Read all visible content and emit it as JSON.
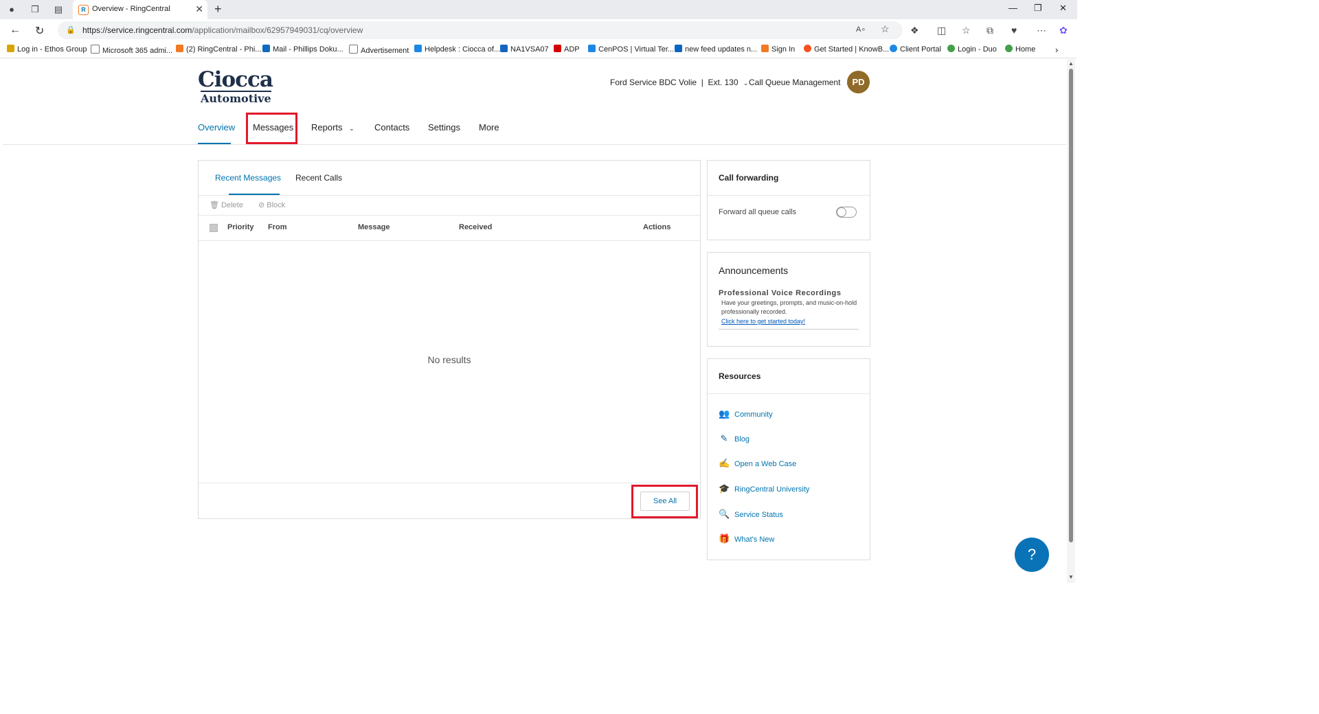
{
  "browser": {
    "tab_title": "Overview - RingCentral",
    "url_host": "https://service.ringcentral.com",
    "url_path": "/application/mailbox/62957949031/cq/overview",
    "bookmarks": [
      {
        "label": "Log in - Ethos Group",
        "color": "#d9a400"
      },
      {
        "label": "Microsoft 365 admi...",
        "color": "#777777"
      },
      {
        "label": "(2) RingCentral - Phi...",
        "color": "#f27a24"
      },
      {
        "label": "Mail - Phillips Doku...",
        "color": "#0f6cbd"
      },
      {
        "label": "Advertisement",
        "color": "#777777"
      },
      {
        "label": "Helpdesk : Ciocca of...",
        "color": "#1e88e5"
      },
      {
        "label": "NA1VSA07",
        "color": "#1565c0"
      },
      {
        "label": "ADP",
        "color": "#d50000"
      },
      {
        "label": "CenPOS | Virtual Ter...",
        "color": "#1e88e5"
      },
      {
        "label": "new feed updates n...",
        "color": "#0a66c2"
      },
      {
        "label": "Sign In",
        "color": "#f27a24"
      },
      {
        "label": "Get Started | KnowB...",
        "color": "#f4511e"
      },
      {
        "label": "Client Portal",
        "color": "#1e88e5"
      },
      {
        "label": "Login - Duo",
        "color": "#43a047"
      },
      {
        "label": "Home",
        "color": "#43a047"
      }
    ]
  },
  "header": {
    "logo_line1": "Ciocca",
    "logo_line2": "Automotive",
    "user_label": "Ford Service BDC Volie  |  Ext. 130",
    "queue_label": "Call Queue Management",
    "avatar_initials": "PD",
    "avatar_color": "#8f6a28"
  },
  "nav": {
    "overview": "Overview",
    "messages": "Messages",
    "reports": "Reports",
    "contacts": "Contacts",
    "settings": "Settings",
    "more": "More"
  },
  "messages_panel": {
    "tab_recent_messages": "Recent Messages",
    "tab_recent_calls": "Recent Calls",
    "delete_label": "Delete",
    "block_label": "Block",
    "columns": [
      "Priority",
      "From",
      "Message",
      "Received",
      "Actions"
    ],
    "empty_text": "No results",
    "see_all_label": "See All"
  },
  "call_forwarding": {
    "title": "Call forwarding",
    "toggle_label": "Forward all queue calls",
    "enabled": false
  },
  "announcements": {
    "title": "Announcements",
    "subtitle": "Professional Voice Recordings",
    "body": "Have your greetings, prompts, and music-on-hold professionally recorded.",
    "link": "Click here to get started today!"
  },
  "resources": {
    "title": "Resources",
    "items": [
      {
        "label": "Community",
        "icon": "community-icon"
      },
      {
        "label": "Blog",
        "icon": "blog-icon"
      },
      {
        "label": "Open a Web Case",
        "icon": "web-case-icon"
      },
      {
        "label": "RingCentral University",
        "icon": "university-icon"
      },
      {
        "label": "Service Status",
        "icon": "service-status-icon"
      },
      {
        "label": "What's New",
        "icon": "gift-icon"
      }
    ]
  },
  "colors": {
    "accent": "#0073ae",
    "highlight": "#e2172b"
  }
}
